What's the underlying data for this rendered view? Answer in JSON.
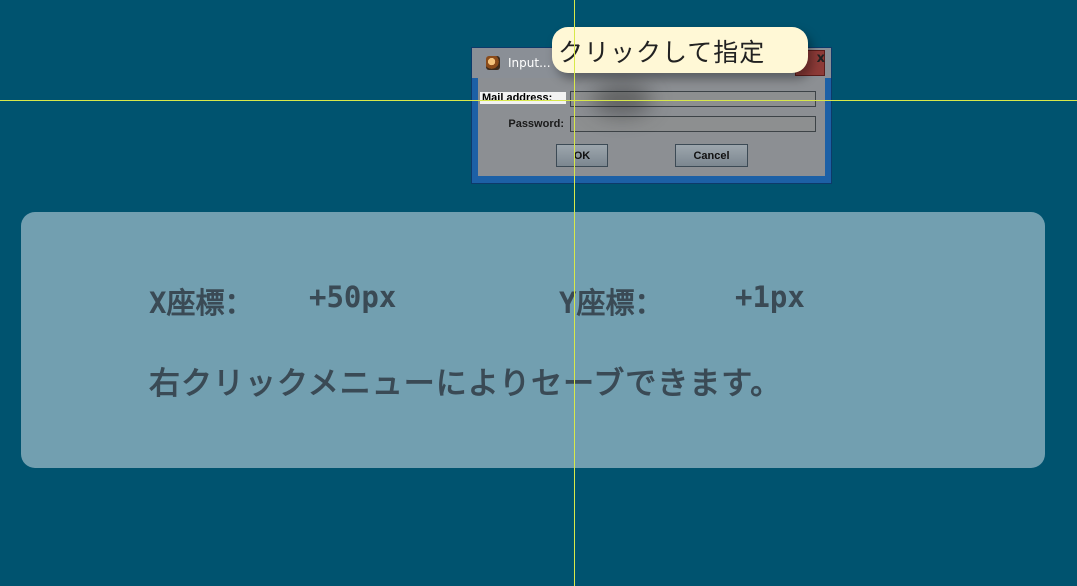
{
  "dialog": {
    "title": "Input...",
    "close_glyph": "x",
    "icon": "java-app-icon",
    "fields": [
      {
        "label": "Mail address:",
        "value": ""
      },
      {
        "label": "Password:",
        "value": ""
      }
    ],
    "ok_label": "OK",
    "cancel_label": "Cancel"
  },
  "callout": {
    "text": "クリックして指定"
  },
  "info": {
    "x_label": "X座標：",
    "x_value": "+50px",
    "y_label": "Y座標：",
    "y_value": "+1px",
    "hint": "右クリックメニューによりセーブできます。"
  },
  "colors": {
    "background": "#00536f",
    "crosshair": "#d8e84a",
    "callout_fill": "#fff8d6",
    "panel_fill": "#bed2dc"
  }
}
